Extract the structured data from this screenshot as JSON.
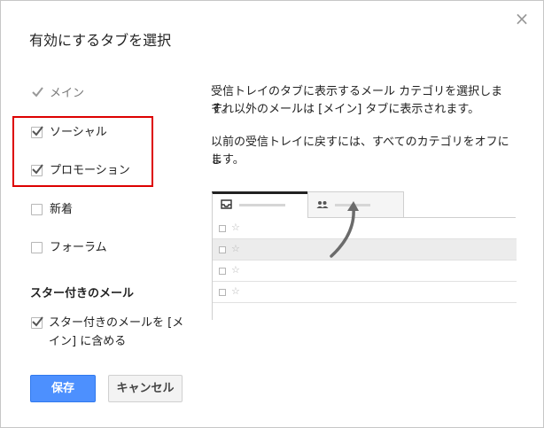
{
  "dialog": {
    "title": "有効にするタブを選択",
    "close_glyph": "×"
  },
  "tabs_options": [
    {
      "label": "メイン",
      "checked": true,
      "disabled": true
    },
    {
      "label": "ソーシャル",
      "checked": true,
      "disabled": false
    },
    {
      "label": "プロモーション",
      "checked": true,
      "disabled": false
    },
    {
      "label": "新着",
      "checked": false,
      "disabled": false
    },
    {
      "label": "フォーラム",
      "checked": false,
      "disabled": false
    }
  ],
  "starred": {
    "section_title": "スター付きのメール",
    "option_line1": "スター付きのメールを [メ",
    "option_line2": "イン] に含める",
    "checked": true
  },
  "description": {
    "line1": "受信トレイのタブに表示するメール カテゴリを選択します。",
    "line2": "それ以外のメールは [メイン] タブに表示されます。",
    "line3": "以前の受信トレイに戻すには、すべてのカテゴリをオフにし",
    "line4": "ます。"
  },
  "preview": {
    "tab1_icon": "inbox-icon",
    "tab2_icon": "people-icon",
    "star_glyph": "☆",
    "rows": [
      {
        "shaded": false
      },
      {
        "shaded": true
      },
      {
        "shaded": false
      },
      {
        "shaded": false
      }
    ]
  },
  "buttons": {
    "save": "保存",
    "cancel": "キャンセル"
  },
  "colors": {
    "primary_button": "#4d90fe",
    "highlight_border": "#dd0000",
    "checkmark": "#555555"
  }
}
